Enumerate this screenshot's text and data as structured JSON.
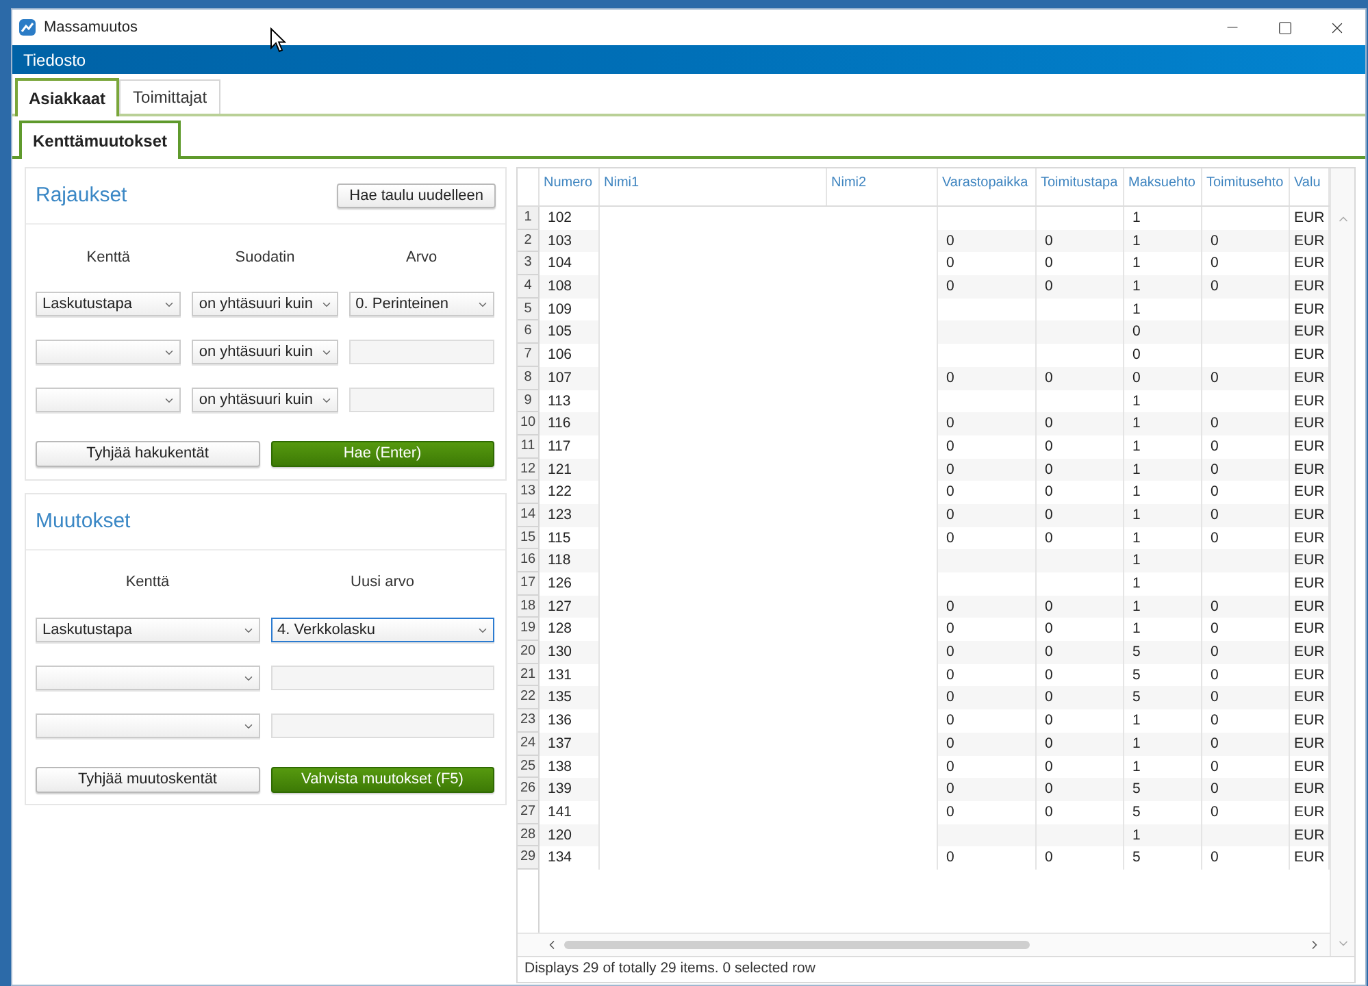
{
  "window": {
    "title": "Massamuutos"
  },
  "menu": [
    {
      "label": "Tiedosto"
    }
  ],
  "tabs": [
    {
      "label": "Asiakkaat",
      "selected": true
    },
    {
      "label": "Toimittajat",
      "selected": false
    }
  ],
  "subtabs": [
    {
      "label": "Kenttämuutokset",
      "selected": true
    }
  ],
  "filters": {
    "title": "Rajaukset",
    "reload_button": "Hae taulu uudelleen",
    "columns": [
      "Kenttä",
      "Suodatin",
      "Arvo"
    ],
    "rows": [
      {
        "field": "Laskutustapa",
        "filter": "on yhtäsuuri kuin",
        "value": "0. Perinteinen",
        "kind": "dropdown"
      },
      {
        "filter": "on yhtäsuuri kuin",
        "kind": "textbox"
      },
      {
        "filter": "on yhtäsuuri kuin",
        "kind": "textbox"
      }
    ],
    "buttons": [
      {
        "label": "Tyhjää hakukentät",
        "kind": "secondary"
      },
      {
        "label": "Hae (Enter)",
        "kind": "primary"
      }
    ]
  },
  "changes": {
    "title": "Muutokset",
    "columns": [
      "Kenttä",
      "Uusi arvo"
    ],
    "rows": [
      {
        "field": "Laskutustapa",
        "new_value": "4. Verkkolasku",
        "kind": "dropdown",
        "focused": true
      },
      {
        "kind": "textbox",
        "focused": false
      },
      {
        "kind": "textbox",
        "focused": false
      }
    ],
    "buttons": [
      {
        "label": "Tyhjää muutoskentät",
        "kind": "secondary"
      },
      {
        "label": "Vahvista muutokset (F5)",
        "kind": "primary"
      }
    ]
  },
  "table": {
    "columns": [
      "Numero",
      "Nimi1",
      "Nimi2",
      "Varastopaikka",
      "Toimitustapa",
      "Maksuehto",
      "Toimitusehto",
      "Valu"
    ],
    "rows": [
      {
        "number": "1",
        "selected": false,
        "cells": [
          "102",
          null,
          null,
          null,
          null,
          "1",
          null,
          "EUR"
        ]
      },
      {
        "number": "2",
        "selected": false,
        "cells": [
          "103",
          null,
          null,
          "0",
          "0",
          "1",
          "0",
          "EUR"
        ]
      },
      {
        "number": "3",
        "selected": false,
        "cells": [
          "104",
          null,
          null,
          "0",
          "0",
          "1",
          "0",
          "EUR"
        ]
      },
      {
        "number": "4",
        "selected": false,
        "cells": [
          "108",
          null,
          null,
          "0",
          "0",
          "1",
          "0",
          "EUR"
        ]
      },
      {
        "number": "5",
        "selected": false,
        "cells": [
          "109",
          null,
          null,
          null,
          null,
          "1",
          null,
          "EUR"
        ]
      },
      {
        "number": "6",
        "selected": false,
        "cells": [
          "105",
          null,
          null,
          null,
          null,
          "0",
          null,
          "EUR"
        ]
      },
      {
        "number": "7",
        "selected": false,
        "cells": [
          "106",
          null,
          null,
          null,
          null,
          "0",
          null,
          "EUR"
        ]
      },
      {
        "number": "8",
        "selected": false,
        "cells": [
          "107",
          null,
          null,
          "0",
          "0",
          "0",
          "0",
          "EUR"
        ]
      },
      {
        "number": "9",
        "selected": false,
        "cells": [
          "113",
          null,
          null,
          null,
          null,
          "1",
          null,
          "EUR"
        ]
      },
      {
        "number": "10",
        "selected": false,
        "cells": [
          "116",
          null,
          null,
          "0",
          "0",
          "1",
          "0",
          "EUR"
        ]
      },
      {
        "number": "11",
        "selected": false,
        "cells": [
          "117",
          null,
          null,
          "0",
          "0",
          "1",
          "0",
          "EUR"
        ]
      },
      {
        "number": "12",
        "selected": false,
        "cells": [
          "121",
          null,
          null,
          "0",
          "0",
          "1",
          "0",
          "EUR"
        ]
      },
      {
        "number": "13",
        "selected": false,
        "cells": [
          "122",
          null,
          null,
          "0",
          "0",
          "1",
          "0",
          "EUR"
        ]
      },
      {
        "number": "14",
        "selected": false,
        "cells": [
          "123",
          null,
          null,
          "0",
          "0",
          "1",
          "0",
          "EUR"
        ]
      },
      {
        "number": "15",
        "selected": false,
        "cells": [
          "115",
          null,
          null,
          "0",
          "0",
          "1",
          "0",
          "EUR"
        ]
      },
      {
        "number": "16",
        "selected": false,
        "cells": [
          "118",
          null,
          null,
          null,
          null,
          "1",
          null,
          "EUR"
        ]
      },
      {
        "number": "17",
        "selected": false,
        "cells": [
          "126",
          null,
          null,
          null,
          null,
          "1",
          null,
          "EUR"
        ]
      },
      {
        "number": "18",
        "selected": false,
        "cells": [
          "127",
          null,
          null,
          "0",
          "0",
          "1",
          "0",
          "EUR"
        ]
      },
      {
        "number": "19",
        "selected": false,
        "cells": [
          "128",
          null,
          null,
          "0",
          "0",
          "1",
          "0",
          "EUR"
        ]
      },
      {
        "number": "20",
        "selected": false,
        "cells": [
          "130",
          null,
          null,
          "0",
          "0",
          "5",
          "0",
          "EUR"
        ]
      },
      {
        "number": "21",
        "selected": false,
        "cells": [
          "131",
          null,
          null,
          "0",
          "0",
          "5",
          "0",
          "EUR"
        ]
      },
      {
        "number": "22",
        "selected": false,
        "cells": [
          "135",
          null,
          null,
          "0",
          "0",
          "5",
          "0",
          "EUR"
        ]
      },
      {
        "number": "23",
        "selected": false,
        "cells": [
          "136",
          null,
          null,
          "0",
          "0",
          "1",
          "0",
          "EUR"
        ]
      },
      {
        "number": "24",
        "selected": false,
        "cells": [
          "137",
          null,
          null,
          "0",
          "0",
          "1",
          "0",
          "EUR"
        ]
      },
      {
        "number": "25",
        "selected": false,
        "cells": [
          "138",
          null,
          null,
          "0",
          "0",
          "1",
          "0",
          "EUR"
        ]
      },
      {
        "number": "26",
        "selected": false,
        "cells": [
          "139",
          null,
          null,
          "0",
          "0",
          "5",
          "0",
          "EUR"
        ]
      },
      {
        "number": "27",
        "selected": false,
        "cells": [
          "141",
          null,
          null,
          "0",
          "0",
          "5",
          "0",
          "EUR"
        ]
      },
      {
        "number": "28",
        "selected": false,
        "cells": [
          "120",
          null,
          null,
          null,
          null,
          "1",
          null,
          "EUR"
        ]
      },
      {
        "number": "29",
        "selected": false,
        "cells": [
          "134",
          null,
          null,
          "0",
          "0",
          "5",
          "0",
          "EUR"
        ]
      }
    ]
  },
  "status_bar": "Displays 29 of totally 29 items. 0 selected row"
}
